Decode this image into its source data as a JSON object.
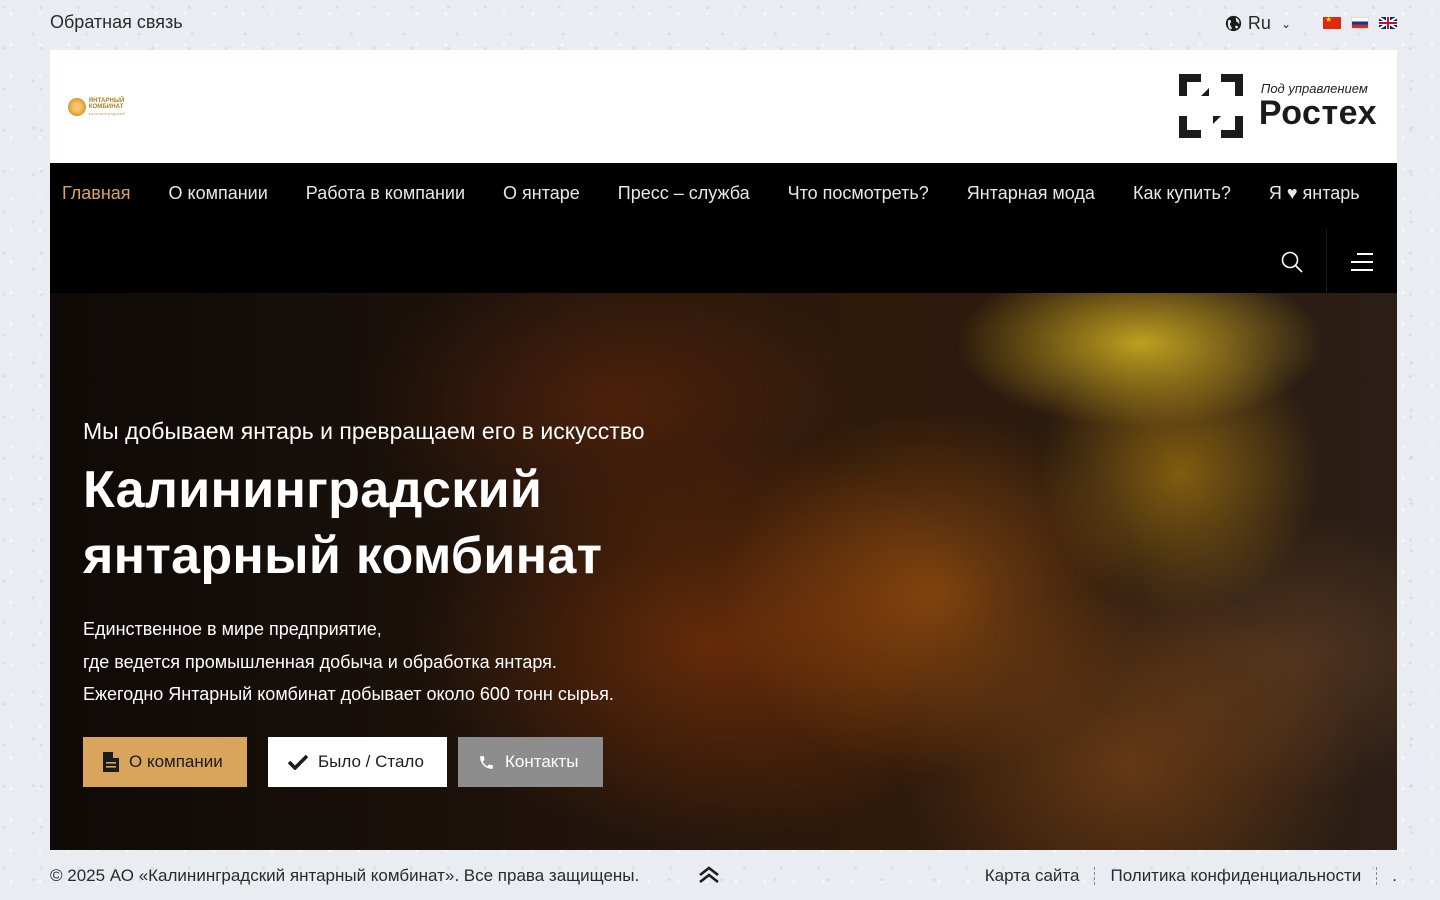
{
  "topbar": {
    "feedback": "Обратная связь",
    "language": "Ru",
    "flags": [
      "cn",
      "ru",
      "en"
    ]
  },
  "header": {
    "company_logo": {
      "line1": "ЯНТАРНЫЙ КОМБИНАТ",
      "line2": "калининградский"
    },
    "rostec": {
      "subtitle": "Под управлением",
      "name": "Ростех"
    }
  },
  "nav": {
    "items": [
      {
        "label": "Главная",
        "active": true
      },
      {
        "label": "О компании",
        "active": false
      },
      {
        "label": "Работа в компании",
        "active": false
      },
      {
        "label": "О янтаре",
        "active": false
      },
      {
        "label": "Пресс – служба",
        "active": false
      },
      {
        "label": "Что посмотреть?",
        "active": false
      },
      {
        "label": "Янтарная мода",
        "active": false
      },
      {
        "label": "Как купить?",
        "active": false
      },
      {
        "label": "Я ♥ янтарь",
        "active": false
      }
    ],
    "icons": {
      "search": "search-icon",
      "menu": "menu-icon"
    }
  },
  "hero": {
    "tagline": "Мы добываем янтарь и превращаем его в искусство",
    "title_line1": "Калининградский",
    "title_line2": "янтарный комбинат",
    "desc": [
      "Единственное в мире предприятие,",
      "где ведется промышленная добыча и обработка янтаря.",
      "Ежегодно Янтарный комбинат добывает около 600 тонн сырья."
    ],
    "buttons": {
      "about": "О компании",
      "before_after": "Было / Стало",
      "contacts": "Контакты"
    }
  },
  "footer": {
    "copyright": "© 2025 АО «Калининградский янтарный комбинат». Все права защищены.",
    "sitemap": "Карта сайта",
    "privacy": "Политика конфиденциальности",
    "dot": "."
  },
  "colors": {
    "accent": "#d9a55c",
    "nav_bg": "#000000",
    "contacts_btn": "#8d8d8d",
    "page_bg": "#e9edf1"
  }
}
